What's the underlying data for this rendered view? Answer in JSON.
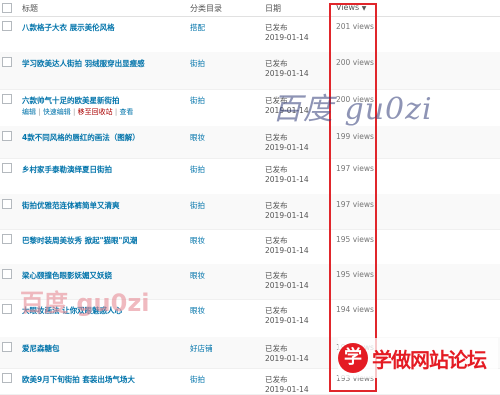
{
  "header": {
    "title": "标题",
    "category": "分类目录",
    "date": "日期",
    "views": "Views",
    "sort_icon": "sort-desc-icon"
  },
  "rows": [
    {
      "title": "八款格子大衣 展示美伦风格",
      "category": "搭配",
      "status": "已发布",
      "date": "2019-01-14",
      "views": "201 views"
    },
    {
      "title": "学习欧美达人街拍 羽绒服穿出显瘦感",
      "category": "街拍",
      "status": "已发布",
      "date": "2019-01-14",
      "views": "200 views"
    },
    {
      "title": "六款帅气十足的欧美星新街拍",
      "category": "街拍",
      "status": "已发布",
      "date": "2019-01-14",
      "views": "200 views",
      "actions": {
        "edit": "编辑",
        "quick_edit": "快速编辑",
        "trash": "移至回收站",
        "view": "查看"
      }
    },
    {
      "title": "4款不同风格的唇红的画法（图解）",
      "category": "眼妆",
      "status": "已发布",
      "date": "2019-01-14",
      "views": "199 views"
    },
    {
      "title": "乡村家手泰勒演绎夏日街拍",
      "category": "街拍",
      "status": "已发布",
      "date": "2019-01-14",
      "views": "197 views"
    },
    {
      "title": "街拍优雅范连体裤简单又清爽",
      "category": "街拍",
      "status": "已发布",
      "date": "2019-01-14",
      "views": "197 views"
    },
    {
      "title": "巴黎时装周美妆秀 掀起\"猫眼\"风潮",
      "category": "眼妆",
      "status": "已发布",
      "date": "2019-01-14",
      "views": "195 views"
    },
    {
      "title": "梁心颐撞色眼影妩媚又妖娆",
      "category": "眼妆",
      "status": "已发布",
      "date": "2019-01-14",
      "views": "195 views"
    },
    {
      "title": "大眼妆画法 让你双眼魅惑人心",
      "category": "眼妆",
      "status": "已发布",
      "date": "2019-01-14",
      "views": "194 views"
    },
    {
      "title": "爱尼森糖包",
      "category": "好店铺",
      "status": "已发布",
      "date": "2019-01-14",
      "views": "194 views"
    },
    {
      "title": "欧美9月下旬街拍 套装出场气场大",
      "category": "街拍",
      "status": "已发布",
      "date": "2019-01-14",
      "views": "193 views"
    }
  ],
  "watermarks": {
    "top": "百度 gu0zi",
    "bottom": "百度 gu0zi"
  },
  "logo": {
    "mark": "学",
    "text": "学做网站论坛"
  },
  "colors": {
    "link": "#0073aa",
    "highlight": "#e0262b",
    "trash": "#a00000",
    "logo": "#e41b23"
  }
}
